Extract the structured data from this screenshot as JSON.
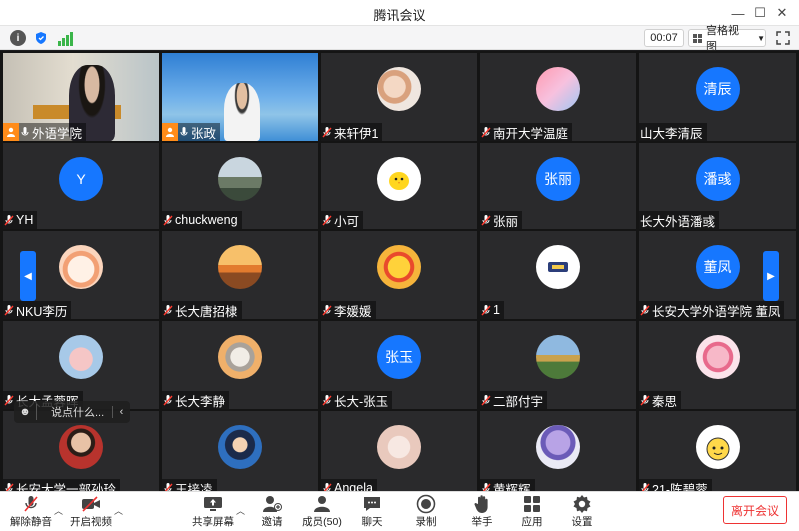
{
  "window": {
    "title": "腾讯会议"
  },
  "toolbar": {
    "timer": "00:07",
    "view_label": "宫格视图"
  },
  "tiles": [
    {
      "name": "外语学院"
    },
    {
      "name": "张政"
    },
    {
      "name": "来轩伊1"
    },
    {
      "name": "南开大学温庭"
    },
    {
      "name": "山大李清辰",
      "avatar_text": "清辰"
    },
    {
      "name": "YH",
      "avatar_text": "Y"
    },
    {
      "name": "chuckweng"
    },
    {
      "name": "小可"
    },
    {
      "name": "张丽",
      "avatar_text": "张丽"
    },
    {
      "name": "长大外语潘彧",
      "avatar_text": "潘彧"
    },
    {
      "name": "NKU李历"
    },
    {
      "name": "长大唐招棣"
    },
    {
      "name": "李媛媛"
    },
    {
      "name": "1"
    },
    {
      "name": "长安大学外语学院 董凤",
      "avatar_text": "董凤"
    },
    {
      "name": "长大孟蓉晖"
    },
    {
      "name": "长大李静"
    },
    {
      "name": "长大-张玉",
      "avatar_text": "张玉"
    },
    {
      "name": "二部付宇"
    },
    {
      "name": "秦思"
    },
    {
      "name": "长安大学一部孙玲"
    },
    {
      "name": "王接凌"
    },
    {
      "name": "Angela"
    },
    {
      "name": "黄辉辉"
    },
    {
      "name": "21-陈碧蓉"
    }
  ],
  "chat": {
    "placeholder": "说点什么..."
  },
  "bottom": {
    "unmute": "解除静音",
    "video": "开启视频",
    "share": "共享屏幕",
    "invite": "邀请",
    "members": "成员(50)",
    "chat": "聊天",
    "record": "录制",
    "raise_hand": "举手",
    "apps": "应用",
    "settings": "设置",
    "leave": "离开会议"
  }
}
